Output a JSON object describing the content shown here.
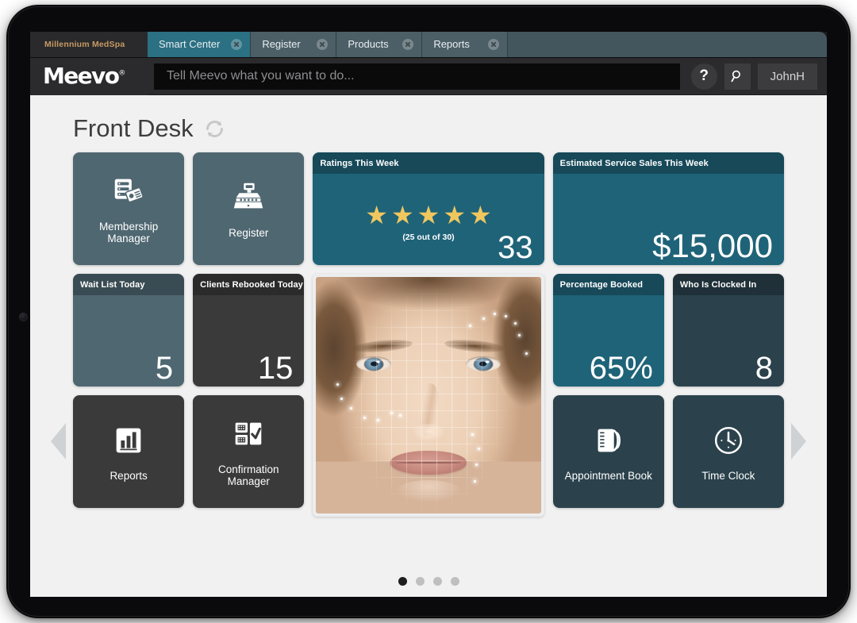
{
  "browser": {
    "tenant_label": "Millennium MedSpa",
    "tabs": [
      {
        "label": "Smart Center",
        "active": true
      },
      {
        "label": "Register",
        "active": false
      },
      {
        "label": "Products",
        "active": false
      },
      {
        "label": "Reports",
        "active": false
      }
    ]
  },
  "header": {
    "logo_text": "Meevo",
    "logo_registered": "®",
    "omnisearch_placeholder": "Tell Meevo what you want to do...",
    "omnisearch_value": "",
    "help_label": "?",
    "search_icon": "magnifier-icon",
    "user_label": "JohnH"
  },
  "page": {
    "title": "Front Desk",
    "refresh_icon": "refresh-icon",
    "prev_icon": "chevron-left-icon",
    "next_icon": "chevron-right-icon"
  },
  "tiles": {
    "membership_manager": {
      "label": "Membership Manager",
      "icon": "membership-card-icon"
    },
    "register": {
      "label": "Register",
      "icon": "cash-register-icon"
    },
    "ratings": {
      "title": "Ratings This Week",
      "stars_filled": 5,
      "stars_total": 5,
      "subtext": "(25 out of 30)",
      "value": "33"
    },
    "service_sales": {
      "title": "Estimated Service Sales This Week",
      "value": "$15,000"
    },
    "wait_list": {
      "title": "Wait List Today",
      "value": "5"
    },
    "clients_rebooked": {
      "title": "Clients Rebooked Today",
      "value": "15"
    },
    "percentage_booked": {
      "title": "Percentage Booked",
      "value": "65%"
    },
    "who_is_clocked_in": {
      "title": "Who Is Clocked In",
      "value": "8"
    },
    "reports": {
      "label": "Reports",
      "icon": "bar-chart-icon"
    },
    "confirmation_manager": {
      "label": "Confirmation Manager",
      "icon": "checklist-icon"
    },
    "appointment_book": {
      "label": "Appointment Book",
      "icon": "notebook-icon"
    },
    "time_clock": {
      "label": "Time Clock",
      "icon": "clock-icon"
    },
    "face_analysis": {
      "alt": "facial-analysis-mesh-photo"
    }
  },
  "pager": {
    "total": 4,
    "active_index": 0
  },
  "colors": {
    "tab_active": "#2b7083",
    "tab_inactive": "#4c5f67",
    "tile_slate": "#4f6771",
    "tile_teal": "#1f6378",
    "tile_dark": "#3a3a3a",
    "tile_navy": "#2b424c",
    "star": "#f0c75e",
    "tenant": "#c79a63"
  }
}
